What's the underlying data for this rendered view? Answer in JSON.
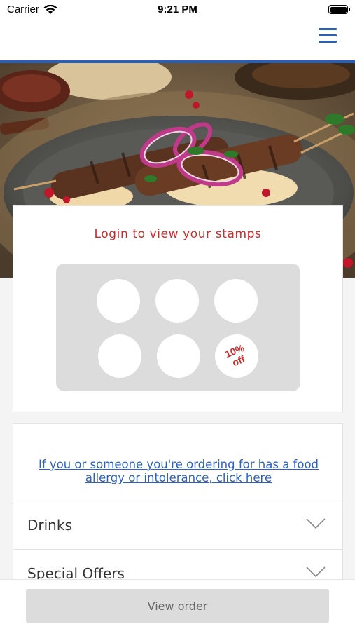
{
  "status_bar": {
    "carrier": "Carrier",
    "time": "9:21 PM",
    "wifi_icon": "wifi-icon",
    "battery_icon": "battery-icon"
  },
  "nav": {
    "menu_icon": "hamburger-menu-icon",
    "accent_color": "#2b5fb4"
  },
  "hero": {
    "image": "grilled kebab skewers with red onion, pomegranate and flatbread"
  },
  "stamps": {
    "title": "Login to view your stamps",
    "title_color": "#cf2a2a",
    "reward_text": "10% off",
    "stamp_count": 6
  },
  "allergy": {
    "link_text": "If you or someone you're ordering for has a food allergy or intolerance, click here",
    "link_color": "#2b62c0"
  },
  "menu_sections": [
    {
      "label": "Drinks",
      "icon": "chevron-down-icon"
    },
    {
      "label": "Special Offers",
      "icon": "chevron-down-icon"
    }
  ],
  "footer": {
    "view_order_label": "View order"
  }
}
